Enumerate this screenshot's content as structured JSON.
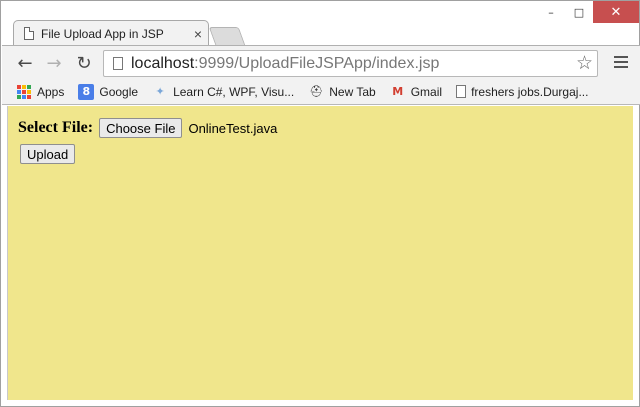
{
  "window": {
    "controls": {
      "minimize": "–",
      "maximize": "□",
      "close": "✕"
    }
  },
  "tab": {
    "title": "File Upload App in JSP",
    "close": "×"
  },
  "toolbar": {
    "back": "←",
    "forward": "→",
    "reload": "↻",
    "url_host": "localhost",
    "url_path": ":9999/UploadFileJSPApp/index.jsp",
    "star": "☆"
  },
  "bookmarks": [
    {
      "label": "Apps",
      "icon": "apps-grid-icon"
    },
    {
      "label": "Google",
      "icon": "google-icon",
      "glyph": "8"
    },
    {
      "label": "Learn C#, WPF, Visu...",
      "icon": "learn-icon",
      "glyph": "✦"
    },
    {
      "label": "New Tab",
      "icon": "newtab-icon",
      "glyph": "⛑"
    },
    {
      "label": "Gmail",
      "icon": "gmail-icon",
      "glyph": "M"
    },
    {
      "label": "freshers jobs.Durgaj...",
      "icon": "page-icon"
    }
  ],
  "form": {
    "label": "Select File:",
    "choose_button": "Choose File",
    "chosen_file": "OnlineTest.java",
    "upload_button": "Upload"
  },
  "colors": {
    "page_background": "#f0e68c",
    "chrome_toolbar": "#f2f2f2",
    "close_button": "#c74f4f"
  }
}
